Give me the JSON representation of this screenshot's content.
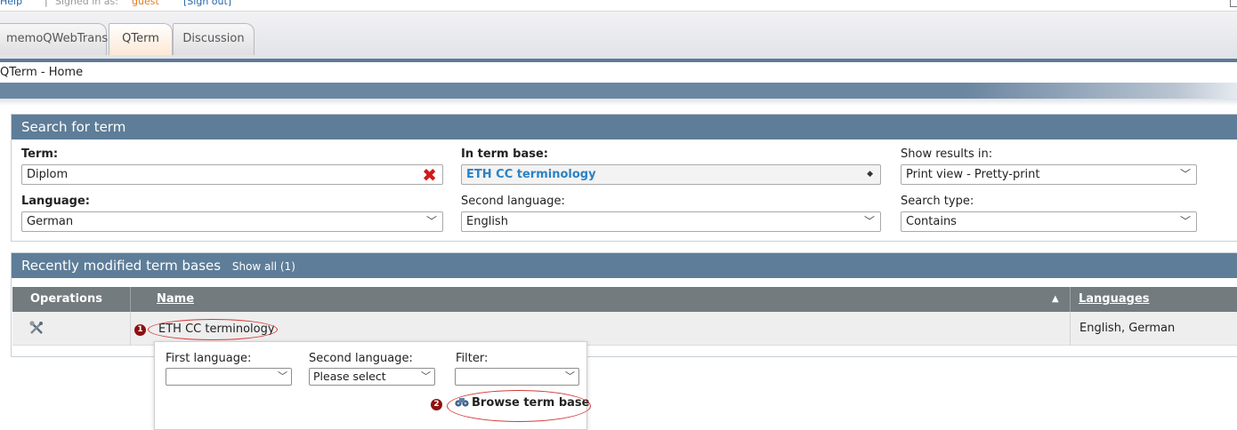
{
  "topbar": {
    "help": "Help",
    "separator": "|",
    "signed_in_label": "Signed in as:",
    "user": "guest",
    "sign_out": "[Sign out]"
  },
  "tabs": [
    {
      "label": "memoQWebTrans",
      "active": false
    },
    {
      "label": "QTerm",
      "active": true
    },
    {
      "label": "Discussion",
      "active": false
    }
  ],
  "breadcrumb": "QTerm - Home",
  "search": {
    "title": "Search for term",
    "term_label": "Term:",
    "term_value": "Diplom",
    "termbase_label": "In term base:",
    "termbase_value": "ETH CC terminology",
    "show_results_label": "Show results in:",
    "show_results_value": "Print view - Pretty-print",
    "language_label": "Language:",
    "language_value": "German",
    "second_language_label": "Second language:",
    "second_language_value": "English",
    "search_type_label": "Search type:",
    "search_type_value": "Contains"
  },
  "recent": {
    "title": "Recently modified term bases",
    "show_all": "Show all (1)",
    "columns": {
      "operations": "Operations",
      "name": "Name",
      "languages": "Languages"
    },
    "rows": [
      {
        "name": "ETH CC terminology",
        "languages": "English, German",
        "operation_icon": "tools-icon"
      }
    ]
  },
  "popup": {
    "first_language_label": "First language:",
    "first_language_value": "",
    "second_language_label": "Second language:",
    "second_language_value": "Please select",
    "filter_label": "Filter:",
    "filter_value": "",
    "browse_button": "Browse term base"
  },
  "annotations": {
    "badge1": "1",
    "badge2": "2",
    "color": "#d53a3a"
  },
  "colors": {
    "header_blue": "#5e7d98",
    "table_header": "#737b7f",
    "accent_link": "#2a82c6",
    "clear_red": "#d01a1a"
  }
}
